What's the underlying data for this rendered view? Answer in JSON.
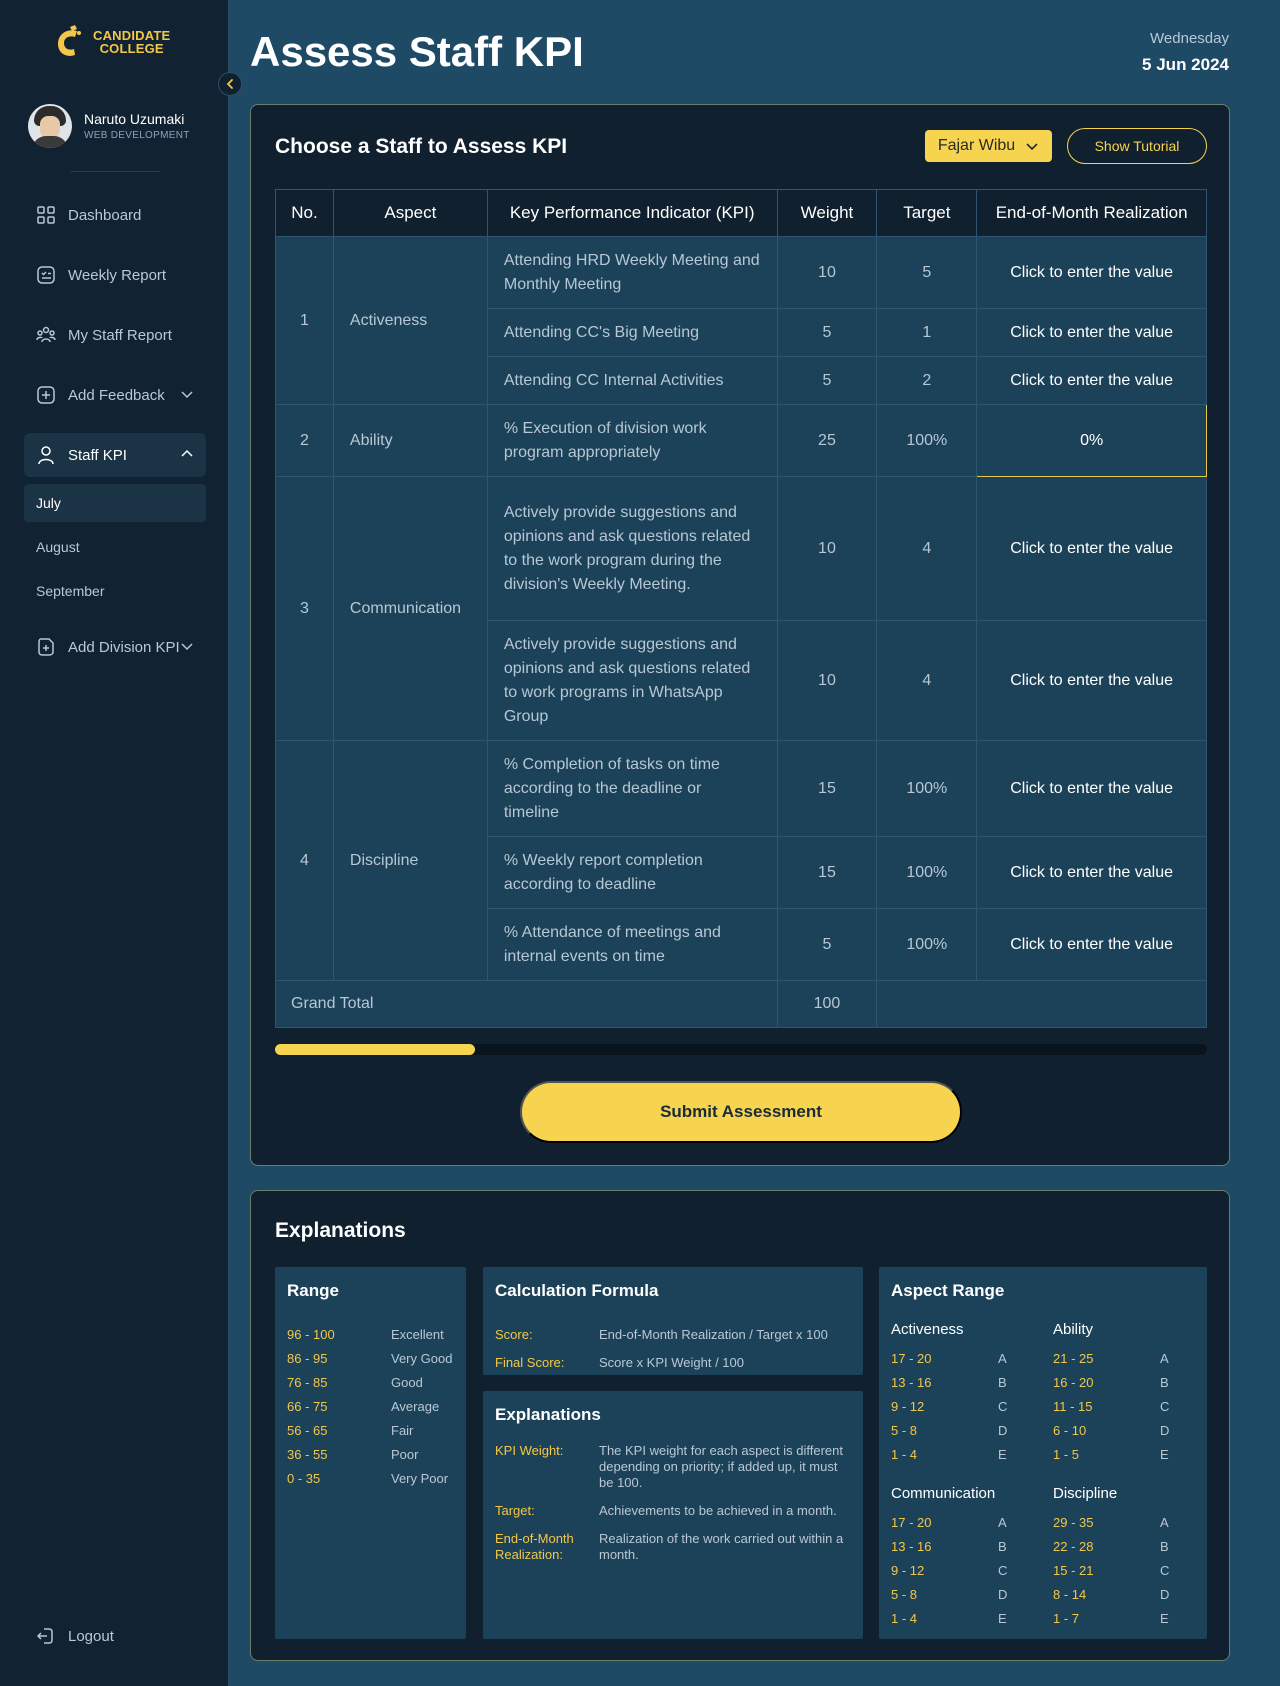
{
  "brand": {
    "line1": "CANDIDATE",
    "line2": "COLLEGE",
    "color": "#f3c747"
  },
  "profile": {
    "name": "Naruto Uzumaki",
    "role": "WEB DEVELOPMENT"
  },
  "nav": {
    "dashboard": "Dashboard",
    "weekly_report": "Weekly Report",
    "my_staff_report": "My Staff Report",
    "add_feedback": "Add Feedback",
    "staff_kpi": "Staff KPI",
    "months": [
      "July",
      "August",
      "September"
    ],
    "add_division_kpi": "Add Division KPI",
    "logout": "Logout"
  },
  "header": {
    "title": "Assess Staff KPI",
    "day": "Wednesday",
    "date": "5 Jun 2024"
  },
  "kpi_card": {
    "title": "Choose a  Staff to Assess KPI",
    "selected_staff": "Fajar Wibu",
    "tutorial_label": "Show Tutorial",
    "columns": [
      "No.",
      "Aspect",
      "Key Performance Indicator (KPI)",
      "Weight",
      "Target",
      "End-of-Month Realization"
    ],
    "aspects": [
      {
        "no": "1",
        "name": "Activeness"
      },
      {
        "no": "2",
        "name": "Ability"
      },
      {
        "no": "3",
        "name": "Communication"
      },
      {
        "no": "4",
        "name": "Discipline"
      }
    ],
    "rows": [
      {
        "kpi": "Attending HRD Weekly Meeting and Monthly Meeting",
        "weight": "10",
        "target": "5",
        "realization": "Click to enter the value"
      },
      {
        "kpi": "Attending CC's Big Meeting",
        "weight": "5",
        "target": "1",
        "realization": "Click to enter the value"
      },
      {
        "kpi": "Attending CC Internal Activities",
        "weight": "5",
        "target": "2",
        "realization": "Click to enter the value"
      },
      {
        "kpi": "% Execution of division work program appropriately",
        "weight": "25",
        "target": "100%",
        "realization": "0%"
      },
      {
        "kpi": "Actively provide suggestions and opinions and ask questions related to the work program during the division's Weekly Meeting.",
        "weight": "10",
        "target": "4",
        "realization": "Click to enter the value"
      },
      {
        "kpi": "Actively provide suggestions and opinions and ask questions related to work programs in WhatsApp Group",
        "weight": "10",
        "target": "4",
        "realization": "Click to enter the value"
      },
      {
        "kpi": "% Completion of tasks on time according to the deadline or timeline",
        "weight": "15",
        "target": "100%",
        "realization": "Click to enter the value"
      },
      {
        "kpi": "% Weekly report completion according to deadline",
        "weight": "15",
        "target": "100%",
        "realization": "Click to enter the value"
      },
      {
        "kpi": "% Attendance of meetings and internal events on time",
        "weight": "5",
        "target": "100%",
        "realization": "Click to enter the value"
      }
    ],
    "grand_total_label": "Grand Total",
    "grand_total_value": "100",
    "progress_fraction": 0.215,
    "submit_label": "Submit Assessment"
  },
  "explanations": {
    "title": "Explanations",
    "range": {
      "title": "Range",
      "items": [
        {
          "range": "96 - 100",
          "label": "Excellent"
        },
        {
          "range": "86 - 95",
          "label": "Very Good"
        },
        {
          "range": "76 - 85",
          "label": "Good"
        },
        {
          "range": "66 - 75",
          "label": "Average"
        },
        {
          "range": "56 - 65",
          "label": "Fair"
        },
        {
          "range": "36 - 55",
          "label": "Poor"
        },
        {
          "range": "0 - 35",
          "label": "Very Poor"
        }
      ]
    },
    "formula": {
      "title": "Calculation Formula",
      "items": [
        {
          "key": "Score:",
          "value": "End-of-Month Realization / Target x 100"
        },
        {
          "key": "Final Score:",
          "value": "Score x KPI Weight / 100"
        }
      ]
    },
    "definitions": {
      "title": "Explanations",
      "items": [
        {
          "key": "KPI Weight:",
          "value": "The KPI weight for each aspect is different depending on priority; if added up, it must be 100."
        },
        {
          "key": "Target:",
          "value": "Achievements to be achieved in a month."
        },
        {
          "key": "End-of-Month Realization:",
          "value": "Realization of the work carried out within a month."
        }
      ]
    },
    "aspect_range": {
      "title": "Aspect Range",
      "groups": [
        {
          "name": "Activeness",
          "items": [
            [
              "17 - 20",
              "A"
            ],
            [
              "13 - 16",
              "B"
            ],
            [
              "9 - 12",
              "C"
            ],
            [
              "5 - 8",
              "D"
            ],
            [
              "1 - 4",
              "E"
            ]
          ]
        },
        {
          "name": "Ability",
          "items": [
            [
              "21 - 25",
              "A"
            ],
            [
              "16 - 20",
              "B"
            ],
            [
              "11 - 15",
              "C"
            ],
            [
              "6 - 10",
              "D"
            ],
            [
              "1 - 5",
              "E"
            ]
          ]
        },
        {
          "name": "Communication",
          "items": [
            [
              "17 - 20",
              "A"
            ],
            [
              "13 - 16",
              "B"
            ],
            [
              "9 - 12",
              "C"
            ],
            [
              "5 - 8",
              "D"
            ],
            [
              "1 - 4",
              "E"
            ]
          ]
        },
        {
          "name": "Discipline",
          "items": [
            [
              "29 - 35",
              "A"
            ],
            [
              "22 - 28",
              "B"
            ],
            [
              "15 - 21",
              "C"
            ],
            [
              "8 - 14",
              "D"
            ],
            [
              "1 - 7",
              "E"
            ]
          ]
        }
      ]
    }
  },
  "colors": {
    "accent": "#f7d44f",
    "background": "#1e4a66",
    "sidebar": "#112333",
    "card": "#10202e",
    "cell": "#1c4259"
  }
}
